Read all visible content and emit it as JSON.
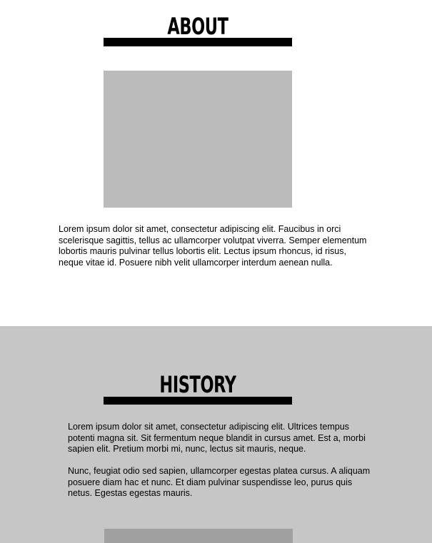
{
  "about": {
    "title": "ABOUT",
    "paragraph": "Lorem ipsum dolor sit amet, consectetur adipiscing elit. Faucibus in orci scelerisque sagittis, tellus ac ullamcorper volutpat viverra. Semper elementum lobortis mauris pulvinar tellus lobortis elit. Lectus ipsum rhoncus, id risus, neque vitae id. Posuere nibh velit ullamcorper interdum aenean nulla."
  },
  "history": {
    "title": "HISTORY",
    "paragraphs": [
      "Lorem ipsum dolor sit amet, consectetur adipiscing elit. Ultrices tempus potenti magna sit. Sit fermentum neque blandit in cursus amet. Est a, morbi sapien elit. Pretium morbi mi, nunc, lectus sit mauris, neque.",
      "Nunc, feugiat odio sed sapien, ullamcorper egestas platea cursus. A aliquam posuere diam hac et nunc. Et diam pulvinar suspendisse leo, purus quis netus. Egestas egestas mauris."
    ]
  },
  "colors": {
    "about_background": "#ffffff",
    "history_background": "#c6c6c6",
    "about_image_placeholder": "#bbbbbb",
    "history_image_placeholder": "#a0a0a0",
    "heading_and_rule": "#000000"
  }
}
